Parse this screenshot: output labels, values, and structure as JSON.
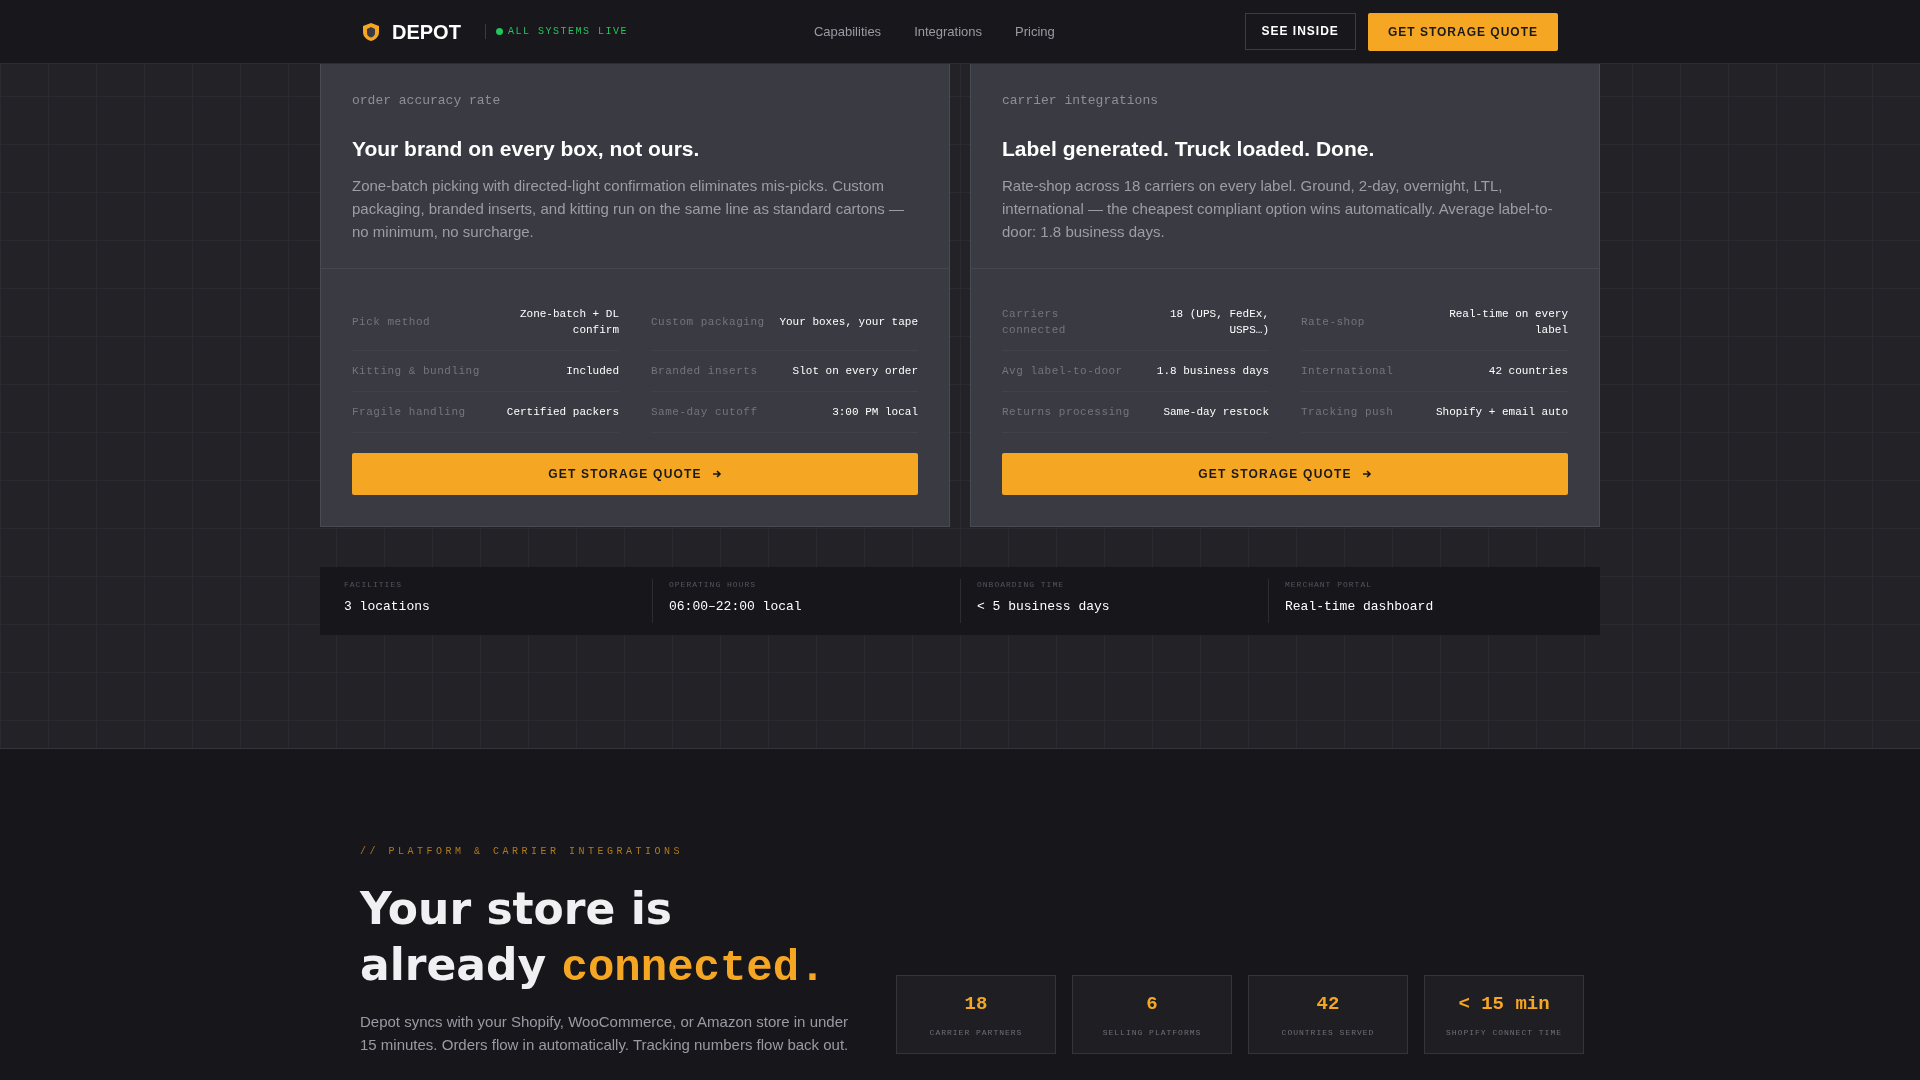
{
  "header": {
    "brand": "DEPOT",
    "status": "ALL SYSTEMS LIVE",
    "nav": [
      "Capabilities",
      "Integrations",
      "Pricing"
    ],
    "secondary_button": "SEE INSIDE",
    "primary_button": "GET STORAGE QUOTE"
  },
  "cards": [
    {
      "caption": "order accuracy rate",
      "title": "Your brand on every box, not ours.",
      "body": "Zone-batch picking with directed-light confirmation eliminates mis-picks. Custom packaging, branded inserts, and kitting run on the same line as standard cartons — no minimum, no surcharge.",
      "specs": [
        {
          "label": "Pick method",
          "value": "Zone-batch + DL confirm"
        },
        {
          "label": "Custom packaging",
          "value": "Your boxes, your tape"
        },
        {
          "label": "Kitting & bundling",
          "value": "Included"
        },
        {
          "label": "Branded inserts",
          "value": "Slot on every order"
        },
        {
          "label": "Fragile handling",
          "value": "Certified packers"
        },
        {
          "label": "Same-day cutoff",
          "value": "3:00 PM local"
        }
      ],
      "button": "GET STORAGE QUOTE"
    },
    {
      "caption": "carrier integrations",
      "title": "Label generated. Truck loaded. Done.",
      "body": "Rate-shop across 18 carriers on every label. Ground, 2-day, overnight, LTL, international — the cheapest compliant option wins automatically. Average label-to-door: 1.8 business days.",
      "specs": [
        {
          "label": "Carriers connected",
          "value": "18 (UPS, FedEx, USPS…)"
        },
        {
          "label": "Rate-shop",
          "value": "Real-time on every label"
        },
        {
          "label": "Avg label-to-door",
          "value": "1.8 business days"
        },
        {
          "label": "International",
          "value": "42 countries"
        },
        {
          "label": "Returns processing",
          "value": "Same-day restock"
        },
        {
          "label": "Tracking push",
          "value": "Shopify + email auto"
        }
      ],
      "button": "GET STORAGE QUOTE"
    }
  ],
  "facts": [
    {
      "label": "FACILITIES",
      "value": "3 locations"
    },
    {
      "label": "OPERATING HOURS",
      "value": "06:00–22:00 local"
    },
    {
      "label": "ONBOARDING TIME",
      "value": "< 5 business days"
    },
    {
      "label": "MERCHANT PORTAL",
      "value": "Real-time dashboard"
    }
  ],
  "integrations": {
    "eyebrow": "// PLATFORM & CARRIER INTEGRATIONS",
    "title": "Your store is already",
    "title_accent": "connected.",
    "body": "Depot syncs with your Shopify, WooCommerce, or Amazon store in under 15 minutes. Orders flow in automatically. Tracking numbers flow back out.",
    "stats": [
      {
        "value": "18",
        "label": "CARRIER PARTNERS"
      },
      {
        "value": "6",
        "label": "SELLING PLATFORMS"
      },
      {
        "value": "42",
        "label": "COUNTRIES SERVED"
      },
      {
        "value": "< 15 min",
        "label": "SHOPIFY CONNECT TIME"
      }
    ]
  }
}
